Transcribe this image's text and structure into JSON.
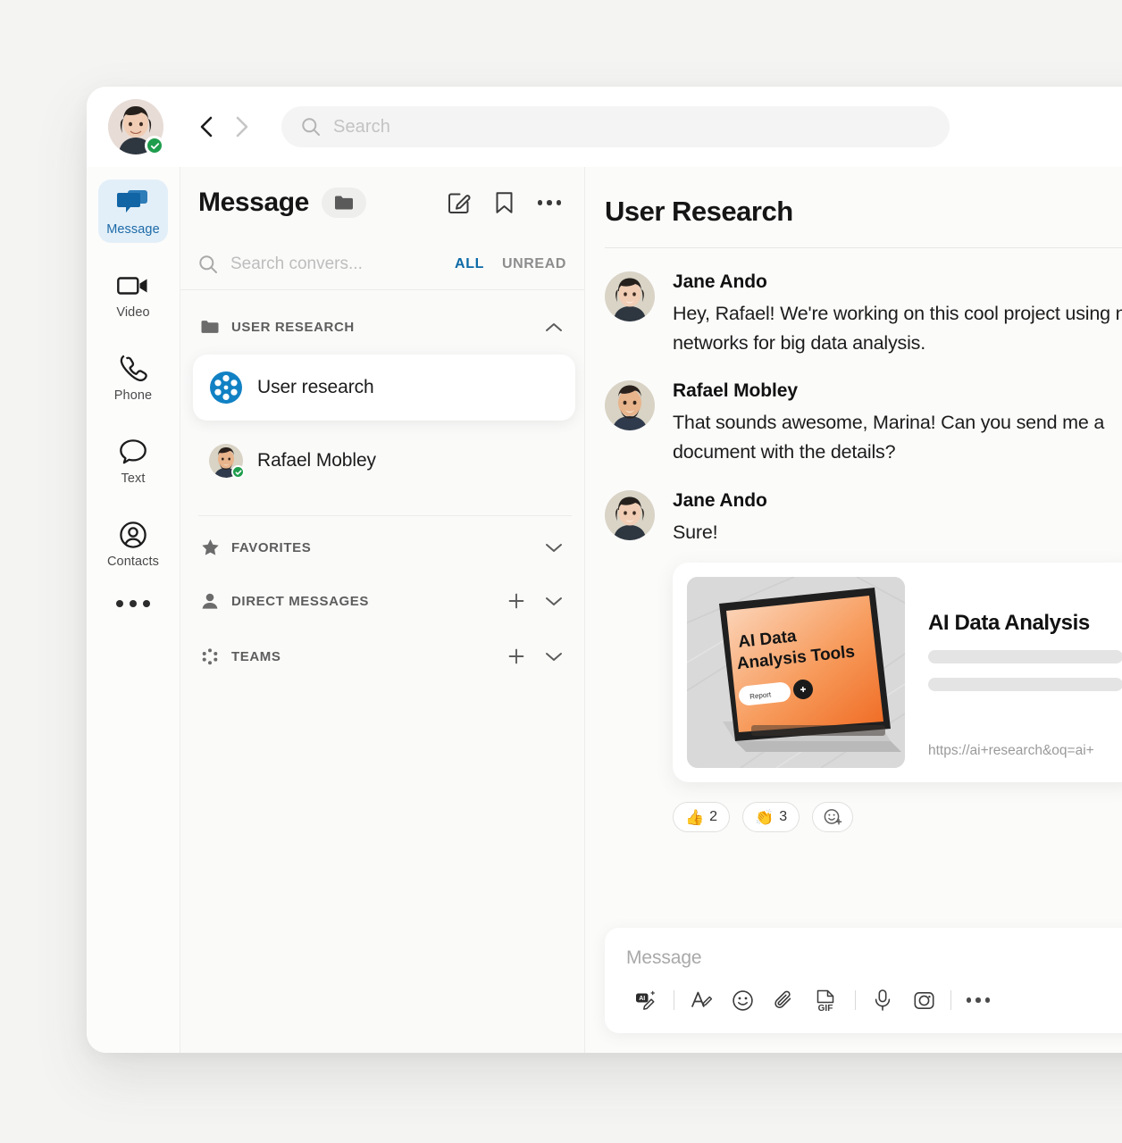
{
  "topbar": {
    "user_avatar_name": "Jane Ando",
    "presence": "available",
    "back_icon": "chevron-left-icon",
    "forward_icon": "chevron-right-icon",
    "search_placeholder": "Search",
    "search_value": ""
  },
  "rail": {
    "items": [
      {
        "label": "Message",
        "icon": "message-bubbles-icon",
        "active": true
      },
      {
        "label": "Video",
        "icon": "video-camera-icon",
        "active": false
      },
      {
        "label": "Phone",
        "icon": "phone-handset-icon",
        "active": false
      },
      {
        "label": "Text",
        "icon": "speech-bubble-icon",
        "active": false
      },
      {
        "label": "Contacts",
        "icon": "person-circle-icon",
        "active": false
      }
    ],
    "more_label": "More"
  },
  "conversations": {
    "title": "Message",
    "folder_icon": "folder-icon",
    "actions": [
      {
        "name": "new-message",
        "icon": "compose-pencil-icon"
      },
      {
        "name": "bookmarks",
        "icon": "bookmark-icon"
      },
      {
        "name": "more",
        "icon": "ellipsis-icon"
      }
    ],
    "search_placeholder": "Search convers...",
    "search_value": "",
    "filters": [
      {
        "label": "ALL",
        "active": true
      },
      {
        "label": "UNREAD",
        "active": false
      }
    ],
    "groups": [
      {
        "label": "USER RESEARCH",
        "icon": "folder-icon",
        "expanded": true,
        "has_add": false,
        "chevron": "chevron-up-icon",
        "items": [
          {
            "name": "User research",
            "icon": "team-channel-icon",
            "selected": true
          },
          {
            "name": "Rafael Mobley",
            "icon": "avatar",
            "selected": false,
            "presence": "available"
          }
        ]
      },
      {
        "label": "FAVORITES",
        "icon": "star-icon",
        "expanded": false,
        "has_add": false,
        "chevron": "chevron-down-icon",
        "items": []
      },
      {
        "label": "DIRECT MESSAGES",
        "icon": "person-icon",
        "expanded": false,
        "has_add": true,
        "chevron": "chevron-down-icon",
        "items": []
      },
      {
        "label": "TEAMS",
        "icon": "team-dots-icon",
        "expanded": false,
        "has_add": true,
        "chevron": "chevron-down-icon",
        "items": []
      }
    ]
  },
  "chat": {
    "title": "User Research",
    "messages": [
      {
        "author": "Jane Ando",
        "avatar": "jane",
        "text": "Hey, Rafael! We're working on this cool project using neural networks for big data analysis."
      },
      {
        "author": "Rafael Mobley",
        "avatar": "rafael",
        "text": "That sounds awesome, Marina! Can you send me a document with the details?"
      },
      {
        "author": "Jane Ando",
        "avatar": "jane",
        "text": "Sure!"
      }
    ],
    "preview": {
      "thumb_heading": "AI Data Analysis Tools",
      "thumb_badge": "Report",
      "title": "AI Data Analysis",
      "url": "https://ai+research&oq=ai+"
    },
    "reactions": [
      {
        "emoji": "👍",
        "count": "2",
        "name": "thumbs-up-reaction"
      },
      {
        "emoji": "👏",
        "count": "3",
        "name": "clap-reaction"
      }
    ],
    "add_reaction_icon": "add-reaction-icon"
  },
  "compose": {
    "placeholder": "Message",
    "value": "",
    "tools": [
      {
        "name": "ai-compose-icon"
      },
      {
        "name": "format-text-icon"
      },
      {
        "name": "emoji-icon"
      },
      {
        "name": "attach-file-icon"
      },
      {
        "name": "gif-icon"
      },
      {
        "name": "microphone-icon"
      },
      {
        "name": "screenshot-icon"
      },
      {
        "name": "more-options-icon"
      }
    ]
  },
  "colors": {
    "accent": "#1d6aa8",
    "filter_active": "#0c6aa6",
    "presence_green": "#1f9d4d",
    "app_bg": "#ffffff",
    "page_bg": "#f4f4f2"
  }
}
